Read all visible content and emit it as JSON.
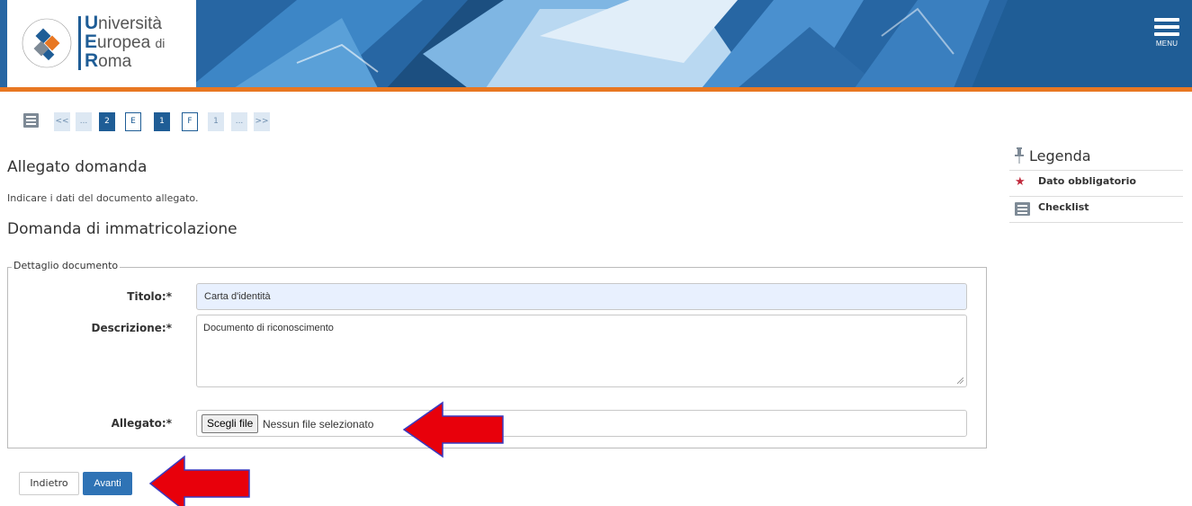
{
  "header": {
    "logo_line1_initial": "U",
    "logo_line1_rest": "niversità",
    "logo_line2_initial": "E",
    "logo_line2_rest": "uropea",
    "logo_line2_suffix": "di",
    "logo_line3_initial": "R",
    "logo_line3_rest": "oma",
    "seal_text_top": "IN BONO MALUM",
    "seal_text_bottom": "VINCE",
    "menu_label": "MENU",
    "brand_color": "#1f5d96",
    "accent_color": "#e87722"
  },
  "pager": {
    "items": [
      "<<",
      "...",
      "2",
      "E",
      "1",
      "F",
      "1",
      "...",
      ">>"
    ]
  },
  "page": {
    "title": "Allegato domanda",
    "subtitle": "Indicare i dati del documento allegato.",
    "section_title": "Domanda di immatricolazione"
  },
  "form": {
    "legend": "Dettaglio documento",
    "titolo_label": "Titolo:*",
    "titolo_value": "Carta d'identità",
    "descrizione_label": "Descrizione:*",
    "descrizione_value": "Documento di riconoscimento",
    "allegato_label": "Allegato:*",
    "file_button": "Scegli file",
    "file_status": "Nessun file selezionato"
  },
  "buttons": {
    "back": "Indietro",
    "next": "Avanti"
  },
  "legenda": {
    "title": "Legenda",
    "items": [
      {
        "icon": "star-icon",
        "label": "Dato obbligatorio"
      },
      {
        "icon": "checklist-icon",
        "label": "Checklist"
      }
    ]
  },
  "annotations": {
    "arrow_color": "#e8000b"
  }
}
